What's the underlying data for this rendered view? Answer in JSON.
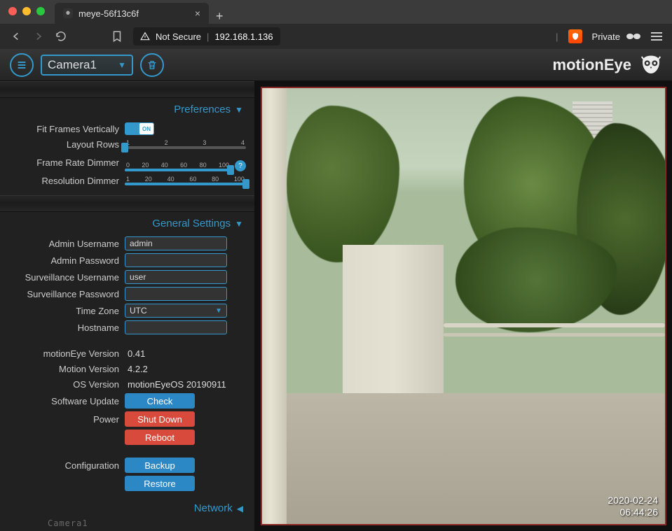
{
  "browser": {
    "tab_title": "meye-56f13c6f",
    "not_secure": "Not Secure",
    "url_ip": "192.168.1.136",
    "private": "Private"
  },
  "header": {
    "camera_selected": "Camera1",
    "brand": "motionEye"
  },
  "preferences": {
    "section_title": "Preferences",
    "fit_frames_label": "Fit Frames Vertically",
    "fit_frames_toggle_text": "ON",
    "layout_rows_label": "Layout Rows",
    "layout_rows_ticks": [
      "1",
      "2",
      "3",
      "4"
    ],
    "layout_rows_value_pct": 0,
    "frame_rate_label": "Frame Rate Dimmer",
    "frame_rate_ticks": [
      "0",
      "20",
      "40",
      "60",
      "80",
      "100"
    ],
    "frame_rate_value_pct": 100,
    "resolution_label": "Resolution Dimmer",
    "resolution_ticks": [
      "1",
      "20",
      "40",
      "60",
      "80",
      "100"
    ],
    "resolution_value_pct": 100
  },
  "general": {
    "section_title": "General Settings",
    "admin_user_label": "Admin Username",
    "admin_user_value": "admin",
    "admin_pass_label": "Admin Password",
    "admin_pass_value": "",
    "surv_user_label": "Surveillance Username",
    "surv_user_value": "user",
    "surv_pass_label": "Surveillance Password",
    "surv_pass_value": "",
    "tz_label": "Time Zone",
    "tz_value": "UTC",
    "hostname_label": "Hostname",
    "hostname_value": "",
    "motioneye_ver_label": "motionEye Version",
    "motioneye_ver": "0.41",
    "motion_ver_label": "Motion Version",
    "motion_ver": "4.2.2",
    "os_ver_label": "OS Version",
    "os_ver": "motionEyeOS 20190911",
    "software_update_label": "Software Update",
    "check_btn": "Check",
    "power_label": "Power",
    "shutdown_btn": "Shut Down",
    "reboot_btn": "Reboot",
    "config_label": "Configuration",
    "backup_btn": "Backup",
    "restore_btn": "Restore"
  },
  "network_section_title": "Network",
  "camera_overlay": {
    "name": "Camera1",
    "date": "2020-02-24",
    "time": "06:44:26"
  }
}
